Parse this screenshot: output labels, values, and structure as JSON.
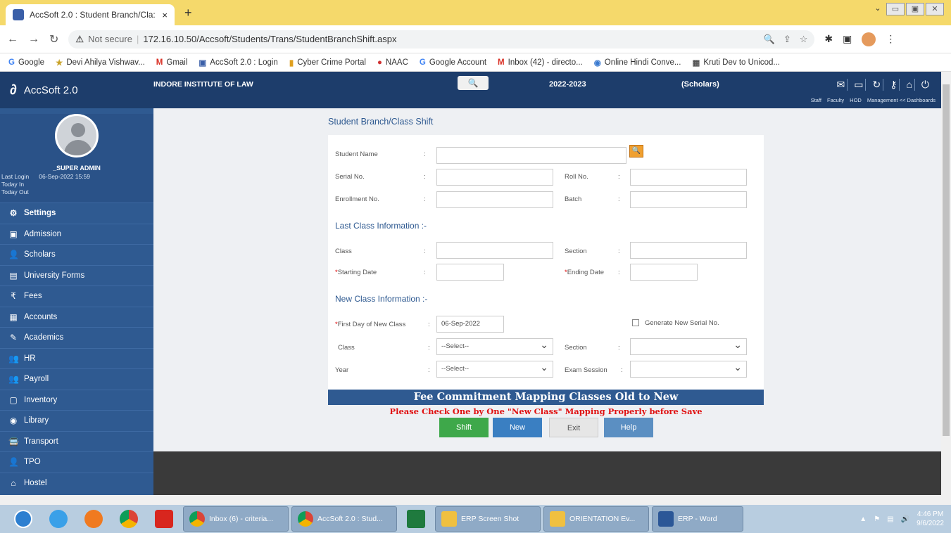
{
  "browser": {
    "tab_title": "AccSoft 2.0 : Student Branch/Cla:",
    "tab_close": "×",
    "new_tab": "+",
    "url_warning": "Not secure",
    "url": "172.16.10.50/Accsoft/Students/Trans/StudentBranchShift.aspx",
    "bookmarks": [
      {
        "icon": "G",
        "label": "Google"
      },
      {
        "icon": "★",
        "label": "Devi Ahilya Vishwav..."
      },
      {
        "icon": "M",
        "label": "Gmail"
      },
      {
        "icon": "▣",
        "label": "AccSoft 2.0 : Login"
      },
      {
        "icon": "▮",
        "label": "Cyber Crime Portal"
      },
      {
        "icon": "●",
        "label": "NAAC"
      },
      {
        "icon": "G",
        "label": "Google Account"
      },
      {
        "icon": "M",
        "label": "Inbox (42) - directo..."
      },
      {
        "icon": "◉",
        "label": "Online Hindi Conve..."
      },
      {
        "icon": "▦",
        "label": "Kruti Dev to Unicod..."
      }
    ]
  },
  "app": {
    "brand": "AccSoft 2.0",
    "user": "_SUPER ADMIN",
    "last_login_label": "Last Login",
    "last_login_value": "06-Sep-2022 15:59",
    "today_in": "Today In",
    "today_out": "Today Out",
    "menu": [
      {
        "icon": "⚙",
        "label": "Settings"
      },
      {
        "icon": "▣",
        "label": "Admission"
      },
      {
        "icon": "👤",
        "label": "Scholars"
      },
      {
        "icon": "▤",
        "label": "University Forms"
      },
      {
        "icon": "₹",
        "label": "Fees"
      },
      {
        "icon": "▦",
        "label": "Accounts"
      },
      {
        "icon": "✎",
        "label": "Academics"
      },
      {
        "icon": "👥",
        "label": "HR"
      },
      {
        "icon": "👥",
        "label": "Payroll"
      },
      {
        "icon": "▢",
        "label": "Inventory"
      },
      {
        "icon": "◉",
        "label": "Library"
      },
      {
        "icon": "🚍",
        "label": "Transport"
      },
      {
        "icon": "👤",
        "label": "TPO"
      },
      {
        "icon": "⌂",
        "label": "Hostel"
      }
    ],
    "institute": "INDORE INSTITUTE OF LAW",
    "session": "2022-2023",
    "mode": "(Scholars)",
    "dash_links": [
      "Staff",
      "Faculty",
      "HOD",
      "Management << Dashboards"
    ]
  },
  "form": {
    "title": "Student Branch/Class Shift",
    "student_name_label": "Student Name",
    "serial_no_label": "Serial No.",
    "roll_no_label": "Roll No.",
    "enrollment_no_label": "Enrollment No.",
    "batch_label": "Batch",
    "last_class_heading": "Last Class Information :-",
    "class_label": "Class",
    "section_label": "Section",
    "starting_date_label": "Starting Date",
    "ending_date_label": "Ending Date",
    "new_class_heading": "New Class Information :-",
    "first_day_label": "First Day of New Class",
    "first_day_value": "06-Sep-2022",
    "generate_serial_label": "Generate New Serial No.",
    "new_class_label": "Class",
    "new_section_label": "Section",
    "year_label": "Year",
    "exam_session_label": "Exam Session",
    "select_placeholder": "--Select--",
    "colon": ":",
    "fee_banner": "Fee Commitment Mapping Classes Old to New",
    "warning": "Please Check One by One \"New Class\" Mapping Properly before Save",
    "buttons": {
      "shift": "Shift",
      "new": "New",
      "exit": "Exit",
      "help": "Help"
    }
  },
  "taskbar": {
    "windows": [
      {
        "label": "Inbox (6) - criteria..."
      },
      {
        "label": "AccSoft 2.0 : Stud..."
      },
      {
        "label": "ERP Screen Shot"
      },
      {
        "label": "ORIENTATION Ev..."
      },
      {
        "label": "ERP - Word"
      }
    ],
    "time": "4:46 PM",
    "date": "9/6/2022"
  }
}
